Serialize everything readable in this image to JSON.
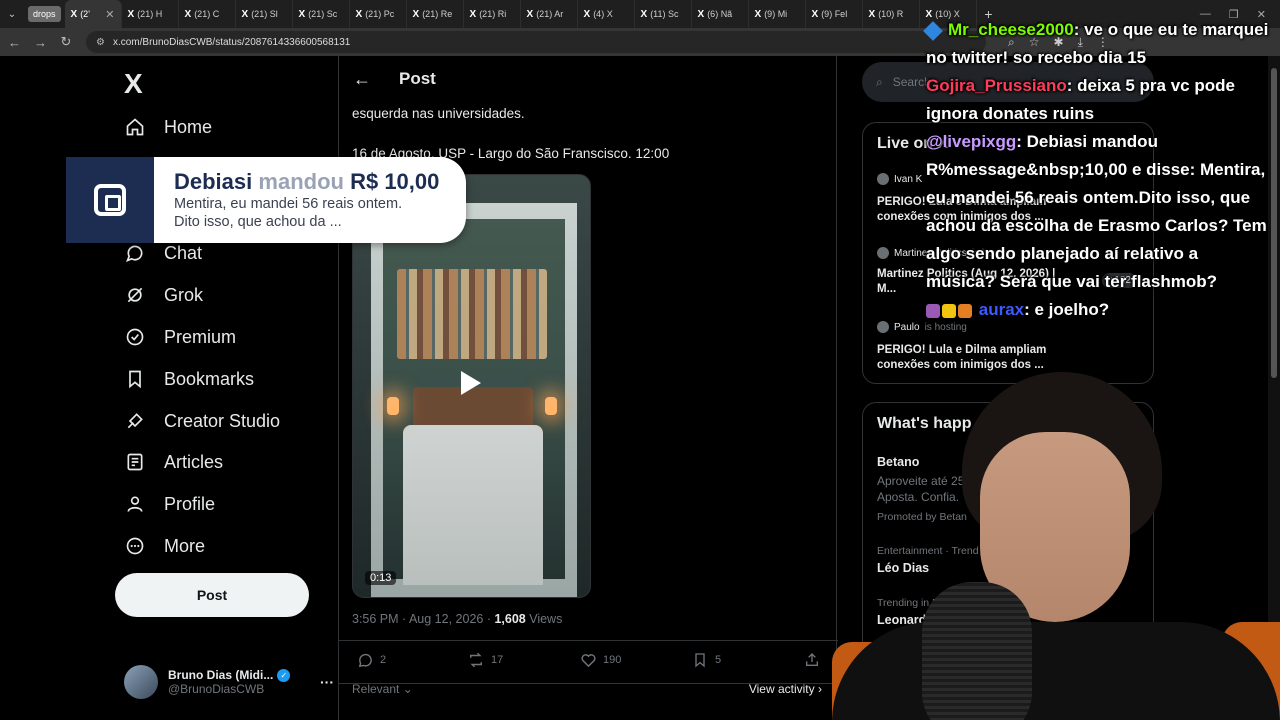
{
  "browser": {
    "tab_group": "drops",
    "tabs": [
      {
        "label": "(2'",
        "active": true
      },
      {
        "label": "(21) H"
      },
      {
        "label": "(21) C"
      },
      {
        "label": "(21) Sl"
      },
      {
        "label": "(21) Sc"
      },
      {
        "label": "(21) Pc"
      },
      {
        "label": "(21) Re"
      },
      {
        "label": "(21) Ri"
      },
      {
        "label": "(21) Ar"
      },
      {
        "label": "(4) X"
      },
      {
        "label": "(11) Sc"
      },
      {
        "label": "(6) Nã"
      },
      {
        "label": "(9) Mi"
      },
      {
        "label": "(9) Fel"
      },
      {
        "label": "(10) R"
      },
      {
        "label": "(10) X"
      }
    ],
    "url": "x.com/BrunoDiasCWB/status/2087614336600568131"
  },
  "sidebar": {
    "logo": "X",
    "items": [
      {
        "label": "Home",
        "icon": "home-icon"
      },
      {
        "label": "Chat",
        "icon": "chat-icon"
      },
      {
        "label": "Grok",
        "icon": "grok-icon"
      },
      {
        "label": "Premium",
        "icon": "premium-icon"
      },
      {
        "label": "Bookmarks",
        "icon": "bookmark-icon"
      },
      {
        "label": "Creator Studio",
        "icon": "creator-studio-icon"
      },
      {
        "label": "Articles",
        "icon": "articles-icon"
      },
      {
        "label": "Profile",
        "icon": "profile-icon"
      },
      {
        "label": "More",
        "icon": "more-icon"
      }
    ],
    "post_button": "Post",
    "account": {
      "display_name": "Bruno Dias (Midi...",
      "username": "@BrunoDiasCWB"
    }
  },
  "main": {
    "header_title": "Post",
    "text_lines": [
      "esquerda nas universidades.",
      "16 de Agosto. USP - Largo do São Franscisco. 12:00"
    ],
    "video_duration": "0:13",
    "meta": {
      "time": "3:56 PM · Aug 12, 2026 · ",
      "views_count": "1,608",
      "views_label": " Views"
    },
    "actions": {
      "replies": "2",
      "reposts": "17",
      "likes": "190",
      "bookmarks": "5"
    },
    "relevant_label": "Relevant",
    "view_activity_label": "View activity"
  },
  "right": {
    "search_placeholder": "Search",
    "live": {
      "heading": "Live on X",
      "spaces": [
        {
          "host": "Ivan K",
          "hosting": "",
          "topic": "PERIGO! Lula e Dilma ampliam conexões com inimigos dos ...",
          "listeners": ""
        },
        {
          "host": "Martinez Politics",
          "hosting": "is hosting",
          "topic": "Martinez Politics (Aug 12, 2026) | M...",
          "listeners": "+182"
        },
        {
          "host": "Paulo",
          "hosting": "is hosting",
          "topic": "PERIGO! Lula e Dilma ampliam conexões com inimigos dos ...",
          "listeners": ""
        }
      ]
    },
    "happening": {
      "heading": "What's happ",
      "trends": [
        {
          "category": "",
          "name": "Betano",
          "promo": "Aproveite até 25% Aposta. Confia.",
          "promoted": "Promoted by Betan"
        },
        {
          "category": "Entertainment · Trend",
          "name": "Léo Dias"
        },
        {
          "category": "Trending in Brazi",
          "name": "Leonardo G"
        }
      ]
    }
  },
  "donation": {
    "donor": "Debiasi",
    "verb": "mandou",
    "amount": "R$ 10,00",
    "message_line1": "Mentira, eu mandei 56 reais ontem.",
    "message_line2": "Dito isso, que achou da ..."
  },
  "chat": [
    {
      "user": "Mr_cheese2000",
      "user_color": "#7CFC00",
      "text": ": ve o que eu te marquei no twitter! so recebo dia 15",
      "icon": "cube-badge-icon"
    },
    {
      "user": "Gojira_Prussiano",
      "user_color": "#FF3B5C",
      "text": ": deixa 5 pra vc pode ignora donates ruins"
    },
    {
      "user": "@livepixgg",
      "user_color": "#C79BFF",
      "text": ": Debiasi mandou R%message&nbsp;10,00 e disse: Mentira, eu mandei 56 reais ontem.Dito isso, que achou da escolha de Erasmo Carlos? Tem algo sendo planejado aí relativo a música? Será que vai ter flashmob?"
    },
    {
      "user": "aurax",
      "user_color": "#3D5AFE",
      "text": ": e joelho?",
      "icon": "emote-badges-icon"
    }
  ]
}
